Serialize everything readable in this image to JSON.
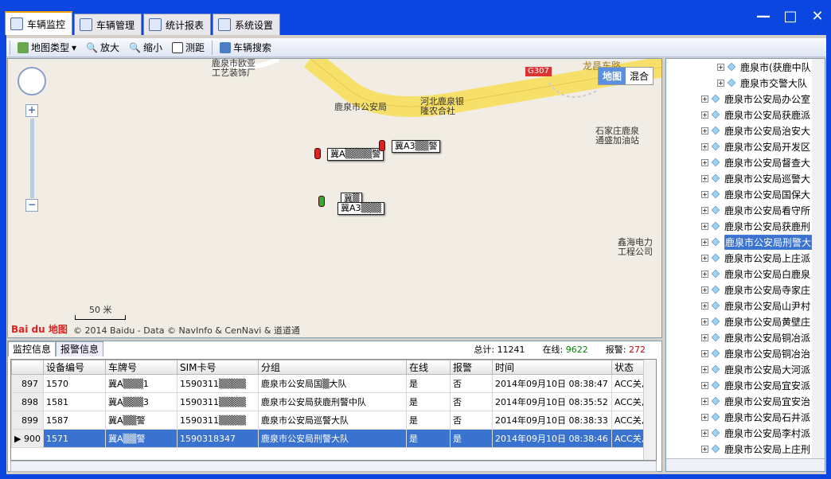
{
  "window": {
    "minimize": "—",
    "maximize": "□",
    "close": "✕"
  },
  "tabs": [
    {
      "label": "车辆监控",
      "icon": "monitor-icon"
    },
    {
      "label": "车辆管理",
      "icon": "vehicle-icon"
    },
    {
      "label": "统计报表",
      "icon": "report-icon"
    },
    {
      "label": "系统设置",
      "icon": "settings-icon"
    }
  ],
  "toolbar": {
    "maptype": "地图类型",
    "zoomin": "放大",
    "zoomout": "缩小",
    "measure": "测距",
    "search": "车辆搜索"
  },
  "map": {
    "maptype_map": "地图",
    "maptype_hybrid": "混合",
    "road_label": "G307",
    "road_name": "龙昌东路",
    "labels": [
      "鹿泉市欧亚\n工艺装饰厂",
      "鹿泉市公安局",
      "河北鹿泉银\n隆农合社",
      "石家庄鹿泉\n通盛加油站",
      "鑫海电力\n工程公司"
    ],
    "plates": [
      "冀A▒▒▒▒警",
      "冀A3▒▒警",
      "冀▒",
      "冀A3▒▒▒"
    ],
    "scale": "50 米",
    "logo": "Bai du 地图",
    "copyright": "© 2014 Baidu - Data © NavInfo & CenNavi & 道道通",
    "zoom_plus": "+",
    "zoom_minus": "−"
  },
  "bottom": {
    "tab_monitor": "监控信息",
    "tab_alarm": "报警信息",
    "total_label": "总计:",
    "total": "11241",
    "online_label": "在线:",
    "online": "9622",
    "alarm_label": "报警:",
    "alarm": "272",
    "columns": [
      "设备编号",
      "车牌号",
      "SIM卡号",
      "分组",
      "在线",
      "报警",
      "时间",
      "状态"
    ],
    "rows": [
      {
        "no": "897",
        "dev": "1570",
        "plate": "冀A▒▒▒1",
        "sim": "1590311▒▒▒▒",
        "group": "鹿泉市公安局国▒大队",
        "online": "是",
        "alarm": "否",
        "time": "2014年09月10日  08:38:47",
        "state": "ACC关, 定"
      },
      {
        "no": "898",
        "dev": "1581",
        "plate": "冀A▒▒▒3",
        "sim": "1590311▒▒▒▒",
        "group": "鹿泉市公安局获鹿刑警中队",
        "online": "是",
        "alarm": "否",
        "time": "2014年09月10日  08:35:52",
        "state": "ACC关, 定"
      },
      {
        "no": "899",
        "dev": "1587",
        "plate": "冀A▒▒警",
        "sim": "1590311▒▒▒▒",
        "group": "鹿泉市公安局巡警大队",
        "online": "是",
        "alarm": "否",
        "time": "2014年09月10日  08:38:33",
        "state": "ACC关, 定"
      },
      {
        "no": "▶ 900",
        "dev": "1571",
        "plate": "冀A▒▒警",
        "sim": "1590318347",
        "group": "鹿泉市公安局刑警大队",
        "online": "是",
        "alarm": "是",
        "time": "2014年09月10日  08:38:46",
        "state": "ACC关, 定"
      }
    ]
  },
  "tree": [
    {
      "label": "鹿泉市(获鹿中队",
      "indent": 1
    },
    {
      "label": "鹿泉市交警大队",
      "indent": 1
    },
    {
      "label": "鹿泉市公安局办公室",
      "indent": 0
    },
    {
      "label": "鹿泉市公安局获鹿派",
      "indent": 0
    },
    {
      "label": "鹿泉市公安局治安大",
      "indent": 0
    },
    {
      "label": "鹿泉市公安局开发区",
      "indent": 0
    },
    {
      "label": "鹿泉市公安局督查大",
      "indent": 0
    },
    {
      "label": "鹿泉市公安局巡警大",
      "indent": 0
    },
    {
      "label": "鹿泉市公安局国保大",
      "indent": 0
    },
    {
      "label": "鹿泉市公安局看守所",
      "indent": 0
    },
    {
      "label": "鹿泉市公安局获鹿刑",
      "indent": 0
    },
    {
      "label": "鹿泉市公安局刑警大",
      "indent": 0,
      "selected": true
    },
    {
      "label": "鹿泉市公安局上庄派",
      "indent": 0
    },
    {
      "label": "鹿泉市公安局白鹿泉",
      "indent": 0
    },
    {
      "label": "鹿泉市公安局寺家庄",
      "indent": 0
    },
    {
      "label": "鹿泉市公安局山尹村",
      "indent": 0
    },
    {
      "label": "鹿泉市公安局黄壁庄",
      "indent": 0
    },
    {
      "label": "鹿泉市公安局铜冶派",
      "indent": 0
    },
    {
      "label": "鹿泉市公安局铜冶治",
      "indent": 0
    },
    {
      "label": "鹿泉市公安局大河派",
      "indent": 0
    },
    {
      "label": "鹿泉市公安局宜安派",
      "indent": 0
    },
    {
      "label": "鹿泉市公安局宜安治",
      "indent": 0
    },
    {
      "label": "鹿泉市公安局石井派",
      "indent": 0
    },
    {
      "label": "鹿泉市公安局李村派",
      "indent": 0
    },
    {
      "label": "鹿泉市公安局上庄刑",
      "indent": 0
    }
  ]
}
